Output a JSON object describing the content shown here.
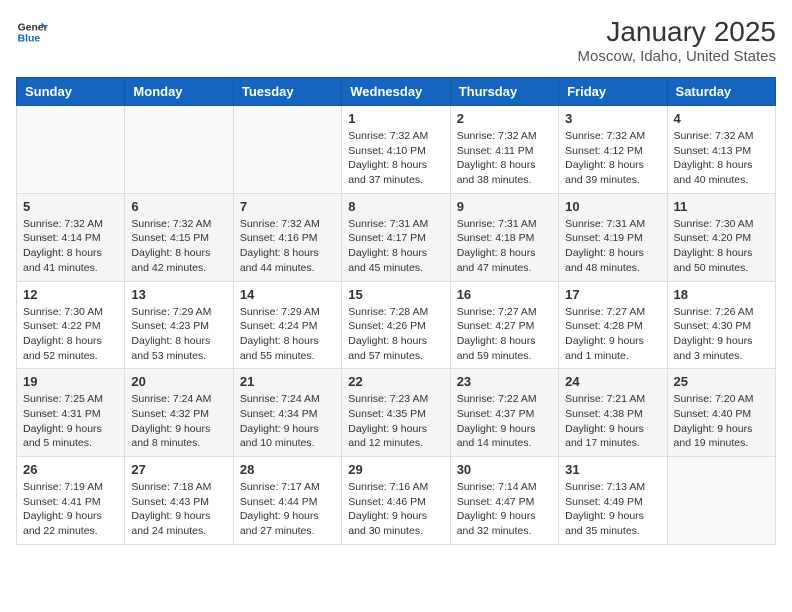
{
  "header": {
    "logo_general": "General",
    "logo_blue": "Blue",
    "title": "January 2025",
    "subtitle": "Moscow, Idaho, United States"
  },
  "days_of_week": [
    "Sunday",
    "Monday",
    "Tuesday",
    "Wednesday",
    "Thursday",
    "Friday",
    "Saturday"
  ],
  "weeks": [
    [
      {
        "day": "",
        "info": ""
      },
      {
        "day": "",
        "info": ""
      },
      {
        "day": "",
        "info": ""
      },
      {
        "day": "1",
        "info": "Sunrise: 7:32 AM\nSunset: 4:10 PM\nDaylight: 8 hours and 37 minutes."
      },
      {
        "day": "2",
        "info": "Sunrise: 7:32 AM\nSunset: 4:11 PM\nDaylight: 8 hours and 38 minutes."
      },
      {
        "day": "3",
        "info": "Sunrise: 7:32 AM\nSunset: 4:12 PM\nDaylight: 8 hours and 39 minutes."
      },
      {
        "day": "4",
        "info": "Sunrise: 7:32 AM\nSunset: 4:13 PM\nDaylight: 8 hours and 40 minutes."
      }
    ],
    [
      {
        "day": "5",
        "info": "Sunrise: 7:32 AM\nSunset: 4:14 PM\nDaylight: 8 hours and 41 minutes."
      },
      {
        "day": "6",
        "info": "Sunrise: 7:32 AM\nSunset: 4:15 PM\nDaylight: 8 hours and 42 minutes."
      },
      {
        "day": "7",
        "info": "Sunrise: 7:32 AM\nSunset: 4:16 PM\nDaylight: 8 hours and 44 minutes."
      },
      {
        "day": "8",
        "info": "Sunrise: 7:31 AM\nSunset: 4:17 PM\nDaylight: 8 hours and 45 minutes."
      },
      {
        "day": "9",
        "info": "Sunrise: 7:31 AM\nSunset: 4:18 PM\nDaylight: 8 hours and 47 minutes."
      },
      {
        "day": "10",
        "info": "Sunrise: 7:31 AM\nSunset: 4:19 PM\nDaylight: 8 hours and 48 minutes."
      },
      {
        "day": "11",
        "info": "Sunrise: 7:30 AM\nSunset: 4:20 PM\nDaylight: 8 hours and 50 minutes."
      }
    ],
    [
      {
        "day": "12",
        "info": "Sunrise: 7:30 AM\nSunset: 4:22 PM\nDaylight: 8 hours and 52 minutes."
      },
      {
        "day": "13",
        "info": "Sunrise: 7:29 AM\nSunset: 4:23 PM\nDaylight: 8 hours and 53 minutes."
      },
      {
        "day": "14",
        "info": "Sunrise: 7:29 AM\nSunset: 4:24 PM\nDaylight: 8 hours and 55 minutes."
      },
      {
        "day": "15",
        "info": "Sunrise: 7:28 AM\nSunset: 4:26 PM\nDaylight: 8 hours and 57 minutes."
      },
      {
        "day": "16",
        "info": "Sunrise: 7:27 AM\nSunset: 4:27 PM\nDaylight: 8 hours and 59 minutes."
      },
      {
        "day": "17",
        "info": "Sunrise: 7:27 AM\nSunset: 4:28 PM\nDaylight: 9 hours and 1 minute."
      },
      {
        "day": "18",
        "info": "Sunrise: 7:26 AM\nSunset: 4:30 PM\nDaylight: 9 hours and 3 minutes."
      }
    ],
    [
      {
        "day": "19",
        "info": "Sunrise: 7:25 AM\nSunset: 4:31 PM\nDaylight: 9 hours and 5 minutes."
      },
      {
        "day": "20",
        "info": "Sunrise: 7:24 AM\nSunset: 4:32 PM\nDaylight: 9 hours and 8 minutes."
      },
      {
        "day": "21",
        "info": "Sunrise: 7:24 AM\nSunset: 4:34 PM\nDaylight: 9 hours and 10 minutes."
      },
      {
        "day": "22",
        "info": "Sunrise: 7:23 AM\nSunset: 4:35 PM\nDaylight: 9 hours and 12 minutes."
      },
      {
        "day": "23",
        "info": "Sunrise: 7:22 AM\nSunset: 4:37 PM\nDaylight: 9 hours and 14 minutes."
      },
      {
        "day": "24",
        "info": "Sunrise: 7:21 AM\nSunset: 4:38 PM\nDaylight: 9 hours and 17 minutes."
      },
      {
        "day": "25",
        "info": "Sunrise: 7:20 AM\nSunset: 4:40 PM\nDaylight: 9 hours and 19 minutes."
      }
    ],
    [
      {
        "day": "26",
        "info": "Sunrise: 7:19 AM\nSunset: 4:41 PM\nDaylight: 9 hours and 22 minutes."
      },
      {
        "day": "27",
        "info": "Sunrise: 7:18 AM\nSunset: 4:43 PM\nDaylight: 9 hours and 24 minutes."
      },
      {
        "day": "28",
        "info": "Sunrise: 7:17 AM\nSunset: 4:44 PM\nDaylight: 9 hours and 27 minutes."
      },
      {
        "day": "29",
        "info": "Sunrise: 7:16 AM\nSunset: 4:46 PM\nDaylight: 9 hours and 30 minutes."
      },
      {
        "day": "30",
        "info": "Sunrise: 7:14 AM\nSunset: 4:47 PM\nDaylight: 9 hours and 32 minutes."
      },
      {
        "day": "31",
        "info": "Sunrise: 7:13 AM\nSunset: 4:49 PM\nDaylight: 9 hours and 35 minutes."
      },
      {
        "day": "",
        "info": ""
      }
    ]
  ]
}
